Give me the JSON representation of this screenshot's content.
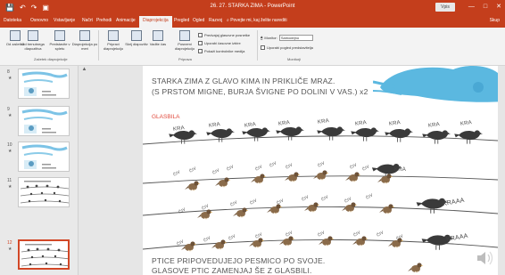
{
  "window": {
    "title": "26. 27. STARKA ZIMA - PowerPoint",
    "signin": "Vpis",
    "window_buttons": [
      "—",
      "□",
      "✕"
    ],
    "qat": [
      "save-icon",
      "undo-icon",
      "redo-icon",
      "present-icon"
    ]
  },
  "tabs": [
    {
      "label": "Datoteka"
    },
    {
      "label": "Osnovno"
    },
    {
      "label": "Vstavljanje"
    },
    {
      "label": "Načrt"
    },
    {
      "label": "Prehodi"
    },
    {
      "label": "Animacije"
    },
    {
      "label": "Diaprojekcija",
      "active": true
    },
    {
      "label": "Pregled"
    },
    {
      "label": "Ogled"
    },
    {
      "label": "Razvoj"
    },
    {
      "label": "⌕ Povejte mi, kaj želite narediti"
    }
  ],
  "share_label": "Skup",
  "ribbon": {
    "buttons": [
      {
        "label": "Od začetka"
      },
      {
        "label": "Od trenutnega diapozitiva"
      },
      {
        "label": "Predstavite v spletu"
      },
      {
        "label": "Diaprojekcija po meri"
      },
      {
        "label": "Pripravi diaprojekcijo"
      },
      {
        "label": "Skrij diapozitiv"
      },
      {
        "label": "Vadite čas"
      },
      {
        "label": "Posnemi diaprojekcijo"
      }
    ],
    "group_start": "Začetek diaprojekcije",
    "group_setup": "Priprava",
    "group_monitors": "Monitorji",
    "checkboxes": [
      "Predvajaj glasovne posnetke",
      "Uporabi časovne izbire",
      "Pokaži kontrolnike medija"
    ],
    "monitor_label": "Monitor:",
    "monitor_value": "Samodejno",
    "presenter_view": "Uporabi pogled predstavitelja"
  },
  "thumbnails": [
    {
      "num": "8",
      "selected": false
    },
    {
      "num": "9",
      "selected": false
    },
    {
      "num": "10",
      "selected": false
    },
    {
      "num": "11",
      "selected": false
    },
    {
      "num": "12",
      "selected": true
    }
  ],
  "slide": {
    "line1": "STARKA ZIMA Z GLAVO KIMA IN PRIKLIČE MRAZ.",
    "line2": "(S PRSTOM MIGNE, BURJA ŠVIGNE PO DOLINI V VAS.) x2",
    "glasbila": "GLASBILA",
    "kra": "KRA",
    "civ": "ČIV",
    "kraaa1": "KRAAA",
    "kraaa2": "KRAAA",
    "bottom1": "PTICE PRIPOVEDUJEJO PESMICO PO SVOJE.",
    "bottom2": "GLASOVE PTIC ZAMENJAJ ŠE Z GLASBILI."
  },
  "colors": {
    "accent": "#c43e1c",
    "selection": "#d24726",
    "cloud": "#5bb8e0",
    "glasbila": "#e04a3c"
  }
}
